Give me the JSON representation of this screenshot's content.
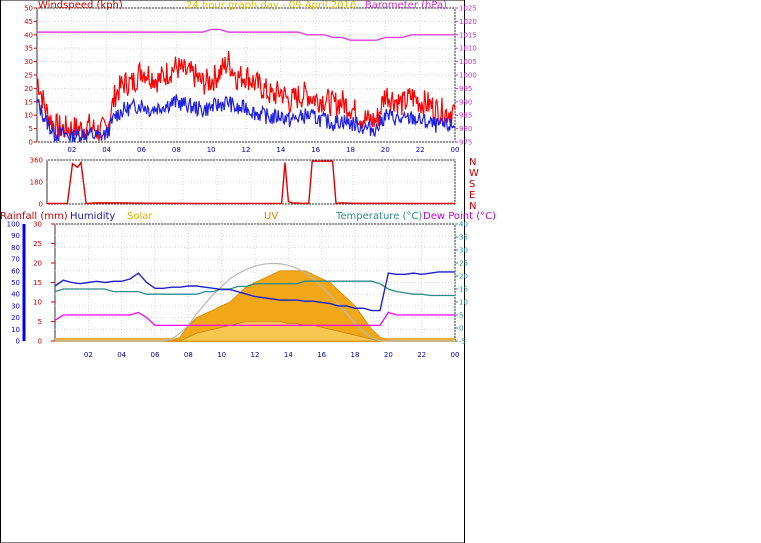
{
  "title": "24 hour graph day - 09 April 2016",
  "colors": {
    "wind_gust": "#ff0000",
    "wind_avg": "#2020e0",
    "barometer": "#e040e0",
    "direction": "#e00000",
    "rainfall": "#cc0000",
    "humidity": "#2020cc",
    "solar": "#e0b000",
    "uv": "#e08000",
    "temperature": "#2e8b8b",
    "dewpoint": "#ff00ff",
    "xaxis": "#0000aa",
    "rain_axis": "#0000ee"
  },
  "chart_data": [
    {
      "type": "line",
      "name": "wind-barometer",
      "xlabel": "",
      "x_ticks": [
        "02",
        "04",
        "06",
        "08",
        "10",
        "12",
        "14",
        "16",
        "18",
        "20",
        "22",
        "00"
      ],
      "y_left_label": "Windspeed (kph)",
      "y_left_ticks": [
        "0",
        "5",
        "10",
        "15",
        "20",
        "25",
        "30",
        "35",
        "40",
        "45",
        "50"
      ],
      "y_left_lim": [
        0,
        50
      ],
      "y_right_label": "Barometer (hPa)",
      "y_right_ticks": [
        "975",
        "980",
        "985",
        "990",
        "995",
        "1000",
        "1005",
        "1010",
        "1015",
        "1020",
        "1025"
      ],
      "y_right_lim": [
        975,
        1025
      ],
      "x_hours": [
        0,
        0.5,
        1,
        1.5,
        2,
        2.5,
        3,
        3.5,
        4,
        4.5,
        5,
        5.5,
        6,
        6.5,
        7,
        7.5,
        8,
        8.5,
        9,
        9.5,
        10,
        10.5,
        11,
        11.5,
        12,
        12.5,
        13,
        13.5,
        14,
        14.5,
        15,
        15.5,
        16,
        16.5,
        17,
        17.5,
        18,
        18.5,
        19,
        19.5,
        20,
        20.5,
        21,
        21.5,
        22,
        22.5,
        23,
        23.5,
        24
      ],
      "series": [
        {
          "name": "Windspeed gust",
          "values": [
            24,
            12,
            6,
            5,
            5,
            5,
            6,
            4,
            5,
            18,
            22,
            22,
            27,
            25,
            23,
            26,
            28,
            26,
            25,
            22,
            23,
            26,
            30,
            24,
            25,
            22,
            20,
            17,
            19,
            15,
            17,
            18,
            16,
            16,
            14,
            15,
            13,
            10,
            8,
            8,
            18,
            16,
            14,
            17,
            15,
            14,
            12,
            11,
            12
          ]
        },
        {
          "name": "Windspeed average",
          "values": [
            15,
            8,
            3,
            3,
            2,
            3,
            3,
            2,
            3,
            10,
            12,
            13,
            14,
            12,
            13,
            14,
            15,
            14,
            13,
            12,
            13,
            14,
            15,
            12,
            13,
            11,
            10,
            9,
            10,
            8,
            9,
            10,
            9,
            8,
            7,
            8,
            7,
            6,
            5,
            5,
            10,
            9,
            8,
            9,
            8,
            7,
            6,
            6,
            6
          ]
        },
        {
          "name": "Barometer",
          "values": [
            1016,
            1016,
            1016,
            1016,
            1016,
            1016,
            1016,
            1016,
            1016,
            1016,
            1016,
            1016,
            1016,
            1016,
            1016,
            1016,
            1016,
            1016,
            1016,
            1016,
            1017,
            1017,
            1016,
            1016,
            1016,
            1016,
            1016,
            1016,
            1016,
            1016,
            1016,
            1015,
            1015,
            1015,
            1014,
            1014,
            1013,
            1013,
            1013,
            1013,
            1014,
            1014,
            1014,
            1015,
            1015,
            1015,
            1015,
            1015,
            1015
          ]
        }
      ]
    },
    {
      "type": "line",
      "name": "wind-direction",
      "y_left_ticks": [
        "0",
        "180",
        "360"
      ],
      "y_left_lim": [
        0,
        360
      ],
      "y_right_ticks": [
        "N",
        "W",
        "S",
        "E",
        "N"
      ],
      "series": [
        {
          "name": "Wind direction",
          "x": [
            0,
            1.2,
            1.5,
            1.8,
            2.0,
            2.3,
            3,
            5,
            7,
            9,
            11,
            13,
            13.8,
            14.0,
            14.2,
            14.4,
            15,
            15.4,
            15.6,
            16.8,
            17.0,
            17.3,
            18,
            20,
            22,
            24
          ],
          "values": [
            5,
            5,
            330,
            300,
            340,
            5,
            10,
            8,
            6,
            5,
            5,
            5,
            5,
            340,
            20,
            10,
            6,
            6,
            350,
            350,
            5,
            10,
            6,
            6,
            5,
            5
          ]
        }
      ]
    },
    {
      "type": "line",
      "name": "rain-humidity-solar-temperature",
      "labels": {
        "rainfall": "Rainfall (mm)",
        "humidity": "Humidity",
        "solar": "Solar",
        "uv": "UV",
        "temperature": "Temperature (°C)",
        "dewpoint": "Dew Point (°C)"
      },
      "y_rain_ticks": [
        "0",
        "10",
        "20",
        "30",
        "40",
        "50",
        "60",
        "70",
        "80",
        "90",
        "100"
      ],
      "y_left_ticks": [
        "0",
        "5",
        "10",
        "15",
        "20",
        "25",
        "30"
      ],
      "y_left_lim": [
        0,
        30
      ],
      "y_right_ticks": [
        "-5",
        "0",
        "5",
        "10",
        "15",
        "20",
        "25",
        "30",
        "35",
        "40"
      ],
      "y_right_lim": [
        -5,
        40
      ],
      "x_hours": [
        0,
        0.5,
        1,
        1.5,
        2,
        2.5,
        3,
        3.5,
        4,
        4.5,
        5,
        5.5,
        6,
        6.5,
        7,
        7.5,
        8,
        8.5,
        9,
        9.5,
        10,
        10.5,
        11,
        11.5,
        12,
        12.5,
        13,
        13.5,
        14,
        14.5,
        15,
        15.5,
        16,
        16.5,
        17,
        17.5,
        18,
        18.5,
        19,
        19.5,
        20,
        20.5,
        21,
        21.5,
        22,
        22.5,
        23,
        23.5,
        24
      ],
      "series": [
        {
          "name": "Humidity",
          "values": [
            47,
            52,
            50,
            49,
            50,
            51,
            50,
            51,
            51,
            53,
            58,
            50,
            45,
            45,
            46,
            46,
            47,
            47,
            46,
            45,
            44,
            44,
            42,
            40,
            38,
            37,
            36,
            35,
            35,
            35,
            34,
            34,
            33,
            32,
            30,
            30,
            28,
            28,
            26,
            26,
            58,
            57,
            57,
            58,
            57,
            58,
            59,
            59,
            59
          ]
        },
        {
          "name": "Temperature",
          "values": [
            14,
            15,
            15,
            15,
            15,
            15,
            15,
            14,
            14,
            14,
            14,
            13,
            13,
            13,
            13,
            13,
            13,
            13,
            14,
            14,
            15,
            15,
            16,
            16,
            17,
            17,
            17,
            17,
            17,
            17,
            18,
            18,
            18,
            18,
            18,
            18,
            18,
            18,
            18,
            17,
            15,
            14,
            13.5,
            13,
            13,
            12.5,
            12.5,
            12.5,
            12.5
          ]
        },
        {
          "name": "Dew Point",
          "values": [
            3,
            5,
            5,
            5,
            5,
            5,
            5,
            5,
            5,
            5,
            6,
            4,
            1,
            1,
            1,
            1,
            1,
            1,
            1,
            1,
            1,
            1,
            1,
            1,
            1,
            1,
            1,
            1,
            1,
            1,
            1,
            1,
            1,
            1,
            1,
            1,
            1,
            1,
            1,
            1,
            6,
            5,
            5,
            5,
            5,
            5,
            5,
            5,
            5
          ]
        },
        {
          "name": "Solar",
          "values": [
            0,
            0,
            0,
            0,
            0,
            0,
            0,
            0,
            0,
            0,
            0,
            0,
            0,
            0,
            0,
            1,
            4,
            6,
            7,
            8,
            9,
            10,
            12,
            14,
            15,
            16,
            17,
            18,
            18,
            18,
            18,
            17,
            16,
            15,
            13,
            11,
            9,
            6,
            3,
            1,
            0,
            0,
            0,
            0,
            0,
            0,
            0,
            0,
            0
          ]
        },
        {
          "name": "Solar theoretical",
          "values": [
            0,
            0,
            0,
            0,
            0,
            0,
            0,
            0,
            0,
            0,
            0,
            0,
            0,
            0,
            0.5,
            2,
            4,
            7,
            9.5,
            12,
            14,
            16,
            17.3,
            18.4,
            19.2,
            19.7,
            19.9,
            19.8,
            19.4,
            18.7,
            17.5,
            16,
            14,
            11.8,
            9.4,
            7,
            4.6,
            2.4,
            0.8,
            0,
            0,
            0,
            0,
            0,
            0,
            0,
            0,
            0,
            0
          ]
        },
        {
          "name": "UV",
          "values": [
            0,
            0,
            0,
            0,
            0,
            0,
            0,
            0,
            0,
            0,
            0,
            0,
            0,
            0,
            0,
            0,
            1,
            2,
            2.5,
            3,
            3.5,
            4,
            4.5,
            5,
            5,
            5,
            5,
            5,
            4.5,
            4.5,
            4,
            4,
            3.5,
            3,
            2.5,
            2,
            1.5,
            1,
            0.5,
            0,
            0,
            0,
            0,
            0,
            0,
            0,
            0,
            0,
            0
          ]
        },
        {
          "name": "Rainfall",
          "values": [
            0,
            0,
            0,
            0,
            0,
            0,
            0,
            0,
            0,
            0,
            0,
            0,
            0,
            0,
            0,
            0,
            0,
            0,
            0,
            0,
            0,
            0,
            0,
            0,
            0,
            0,
            0,
            0,
            0,
            0,
            0,
            0,
            0,
            0,
            0,
            0,
            0,
            0,
            0,
            0,
            0,
            0,
            0,
            0,
            0,
            0,
            0,
            0,
            0
          ]
        }
      ]
    }
  ]
}
